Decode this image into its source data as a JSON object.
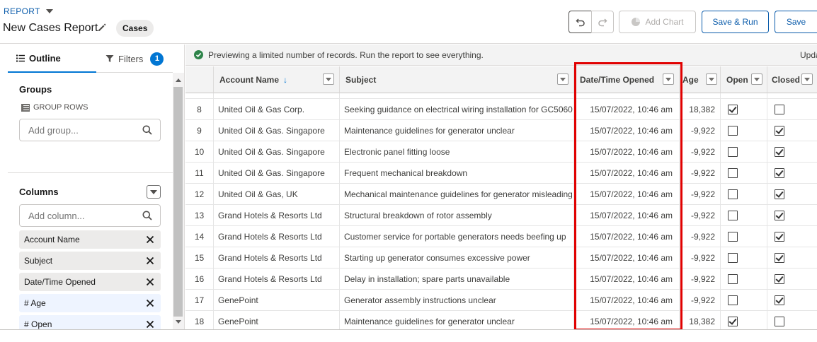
{
  "header": {
    "report_label": "REPORT",
    "title": "New Cases Report",
    "object_pill": "Cases",
    "buttons": {
      "add_chart": "Add Chart",
      "save_run": "Save & Run",
      "save": "Save"
    }
  },
  "left_panel": {
    "tabs": {
      "outline": "Outline",
      "filters": "Filters",
      "filters_count": "1"
    },
    "groups": {
      "title": "Groups",
      "group_rows_label": "GROUP ROWS",
      "add_group_placeholder": "Add group..."
    },
    "columns": {
      "title": "Columns",
      "add_column_placeholder": "Add column...",
      "items": [
        {
          "label": "Account Name",
          "numeric": false
        },
        {
          "label": "Subject",
          "numeric": false
        },
        {
          "label": "Date/Time Opened",
          "numeric": false
        },
        {
          "label": "# Age",
          "numeric": true
        },
        {
          "label": "# Open",
          "numeric": true
        }
      ]
    }
  },
  "info_bar": {
    "message": "Previewing a limited number of records. Run the report to see everything.",
    "update_text": "Upda"
  },
  "table": {
    "headers": {
      "account": "Account Name",
      "subject": "Subject",
      "date": "Date/Time Opened",
      "age": "Age",
      "open": "Open",
      "closed": "Closed"
    },
    "rows": [
      {
        "num": "8",
        "account": "United Oil & Gas Corp.",
        "subject": "Seeking guidance on electrical wiring installation for GC5060",
        "date": "15/07/2022, 10:46 am",
        "age": "18,382",
        "open": true,
        "closed": false
      },
      {
        "num": "9",
        "account": "United Oil & Gas. Singapore",
        "subject": "Maintenance guidelines for generator unclear",
        "date": "15/07/2022, 10:46 am",
        "age": "-9,922",
        "open": false,
        "closed": true
      },
      {
        "num": "10",
        "account": "United Oil & Gas. Singapore",
        "subject": "Electronic panel fitting loose",
        "date": "15/07/2022, 10:46 am",
        "age": "-9,922",
        "open": false,
        "closed": true
      },
      {
        "num": "11",
        "account": "United Oil & Gas. Singapore",
        "subject": "Frequent mechanical breakdown",
        "date": "15/07/2022, 10:46 am",
        "age": "-9,922",
        "open": false,
        "closed": true
      },
      {
        "num": "12",
        "account": "United Oil & Gas, UK",
        "subject": "Mechanical maintenance guidelines for generator misleading",
        "date": "15/07/2022, 10:46 am",
        "age": "-9,922",
        "open": false,
        "closed": true
      },
      {
        "num": "13",
        "account": "Grand Hotels & Resorts Ltd",
        "subject": "Structural breakdown of rotor assembly",
        "date": "15/07/2022, 10:46 am",
        "age": "-9,922",
        "open": false,
        "closed": true
      },
      {
        "num": "14",
        "account": "Grand Hotels & Resorts Ltd",
        "subject": "Customer service for portable generators needs beefing up",
        "date": "15/07/2022, 10:46 am",
        "age": "-9,922",
        "open": false,
        "closed": true
      },
      {
        "num": "15",
        "account": "Grand Hotels & Resorts Ltd",
        "subject": "Starting up generator consumes excessive power",
        "date": "15/07/2022, 10:46 am",
        "age": "-9,922",
        "open": false,
        "closed": true
      },
      {
        "num": "16",
        "account": "Grand Hotels & Resorts Ltd",
        "subject": "Delay in installation; spare parts unavailable",
        "date": "15/07/2022, 10:46 am",
        "age": "-9,922",
        "open": false,
        "closed": true
      },
      {
        "num": "17",
        "account": "GenePoint",
        "subject": "Generator assembly instructions unclear",
        "date": "15/07/2022, 10:46 am",
        "age": "-9,922",
        "open": false,
        "closed": true
      },
      {
        "num": "18",
        "account": "GenePoint",
        "subject": "Maintenance guidelines for generator unclear",
        "date": "15/07/2022, 10:46 am",
        "age": "18,382",
        "open": true,
        "closed": false
      }
    ]
  },
  "colors": {
    "brand_blue": "#0176d3",
    "link_blue": "#0b5cab",
    "highlight_red": "#e00000",
    "success_green": "#2e844a"
  }
}
